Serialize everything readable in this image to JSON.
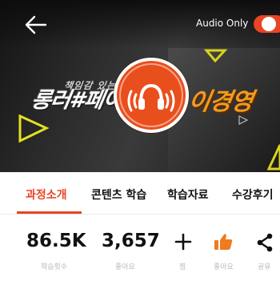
{
  "header": {
    "audio_only_label": "Audio Only",
    "audio_only_enabled": true,
    "accent_color": "#e94425"
  },
  "banner": {
    "subtitle": "책임감 있는 ",
    "title_left": "롱러#페이",
    "title_right": "이경영",
    "badge_icon": "headphones-icon"
  },
  "tabs": [
    {
      "label": "과정소개",
      "active": true
    },
    {
      "label": "콘텐츠 학습",
      "active": false
    },
    {
      "label": "학습자료",
      "active": false
    },
    {
      "label": "수강후기",
      "active": false
    }
  ],
  "stats": {
    "views": {
      "value": "86.5K",
      "label": "학습횟수"
    },
    "likes": {
      "value": "3,657",
      "label": "좋아요"
    },
    "add": {
      "icon": "plus-icon",
      "label": "찜"
    },
    "like": {
      "icon": "thumbs-up-icon",
      "label": "좋아요"
    },
    "share": {
      "icon": "share-icon",
      "label": "공유"
    }
  }
}
